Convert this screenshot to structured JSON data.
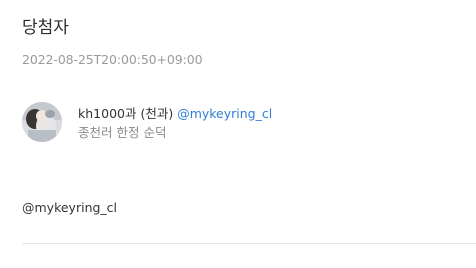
{
  "section": {
    "title": "당첨자",
    "timestamp": "2022-08-25T20:00:50+09:00"
  },
  "winner": {
    "name": "kh1000과 (천과)",
    "handle": "@mykeyring_cl",
    "description": "종천러 한정 순덕"
  },
  "body": {
    "mention": "@mykeyring_cl"
  },
  "colors": {
    "handle": "#2d7fd6",
    "muted": "#9a9a9a",
    "text": "#333333"
  }
}
